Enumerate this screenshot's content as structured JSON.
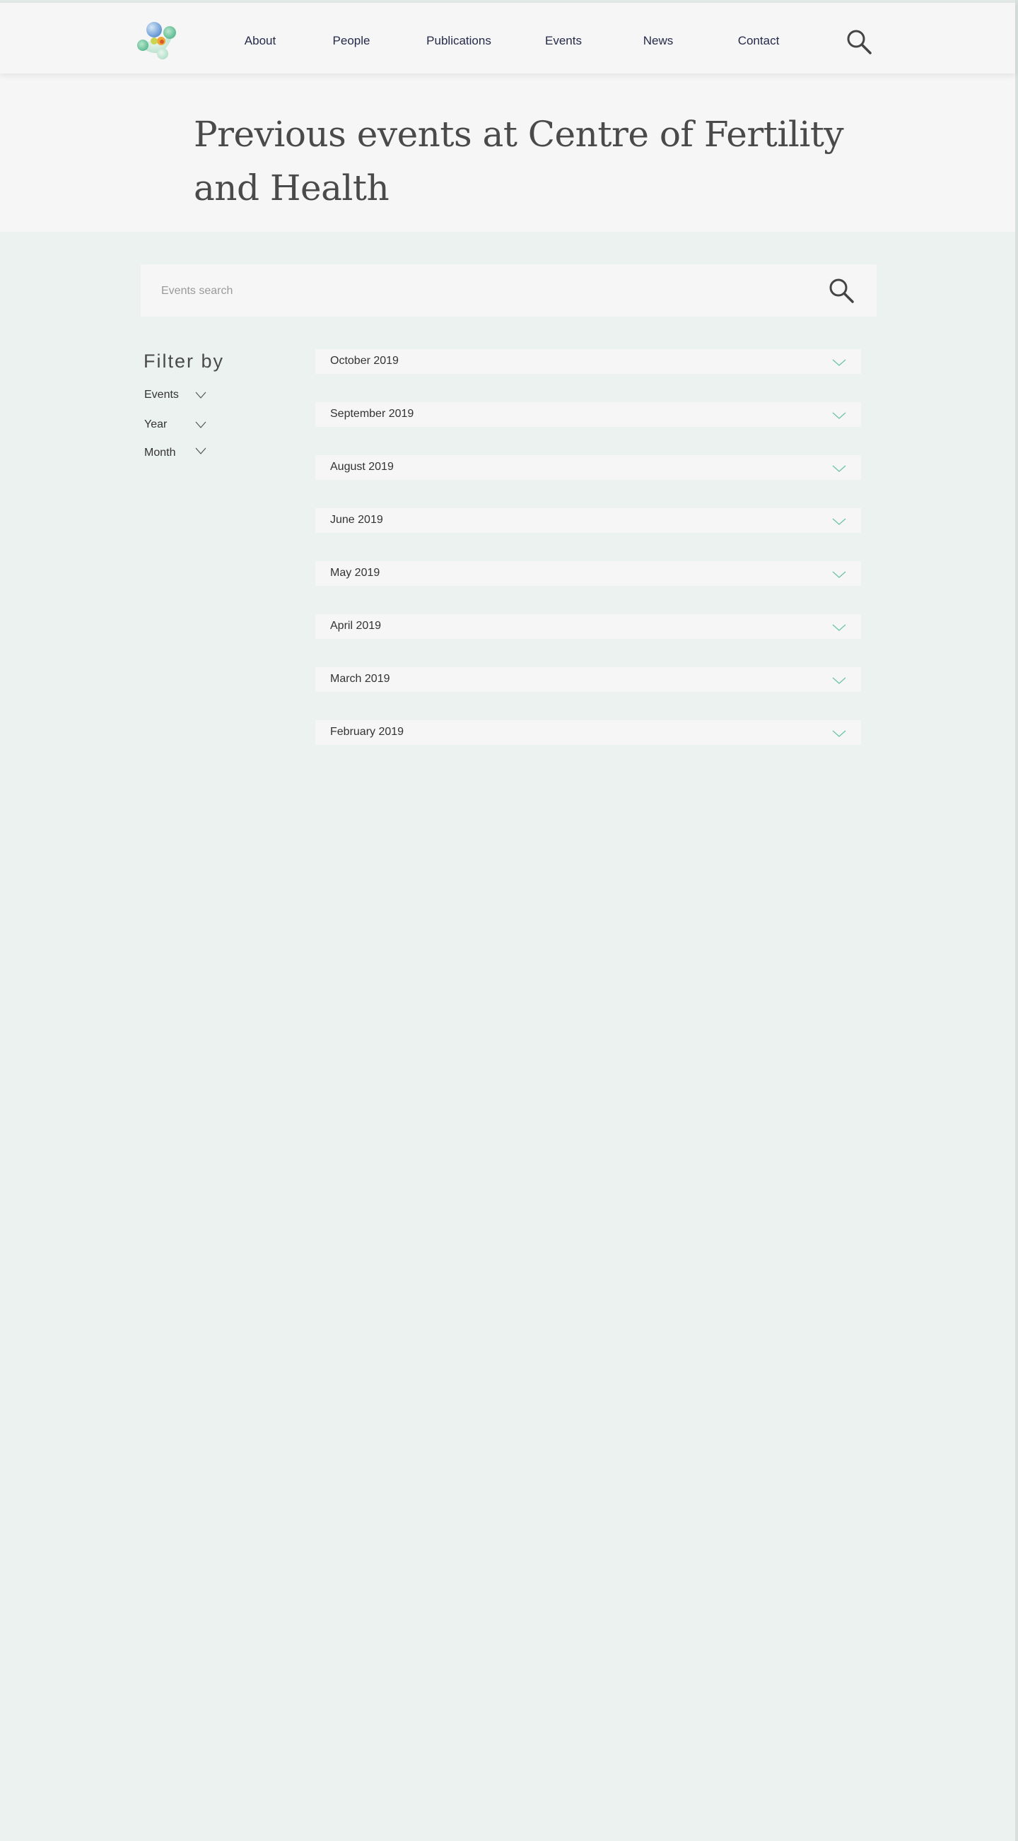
{
  "nav": {
    "items": [
      {
        "label": "About"
      },
      {
        "label": "People"
      },
      {
        "label": "Publications"
      },
      {
        "label": "Events"
      },
      {
        "label": "News"
      },
      {
        "label": "Contact"
      }
    ],
    "search_icon": "search-icon",
    "logo_icon": "molecule-logo"
  },
  "hero": {
    "title": "Previous events at Centre of Fertility and Health"
  },
  "search": {
    "placeholder": "Events search",
    "value": "",
    "icon": "search-icon"
  },
  "filter": {
    "title": "Filter by",
    "items": [
      {
        "label": "Events"
      },
      {
        "label": "Year"
      },
      {
        "label": "Month"
      }
    ],
    "icon": "chevron-down-icon"
  },
  "months": [
    {
      "label": "October 2019"
    },
    {
      "label": "September 2019"
    },
    {
      "label": "August 2019"
    },
    {
      "label": "June 2019"
    },
    {
      "label": "May 2019"
    },
    {
      "label": "April 2019"
    },
    {
      "label": "March 2019"
    },
    {
      "label": "February 2019"
    }
  ],
  "colors": {
    "page_bg": "#ecf2ef",
    "panel_bg": "#f6f6f6",
    "nav_text": "#262a4a",
    "title_text": "#4a4a4a",
    "accent_green": "#6cc4a4",
    "logo_blue": "#6f9fd8",
    "logo_green": "#5bb98c",
    "logo_orange": "#f0a53a"
  }
}
